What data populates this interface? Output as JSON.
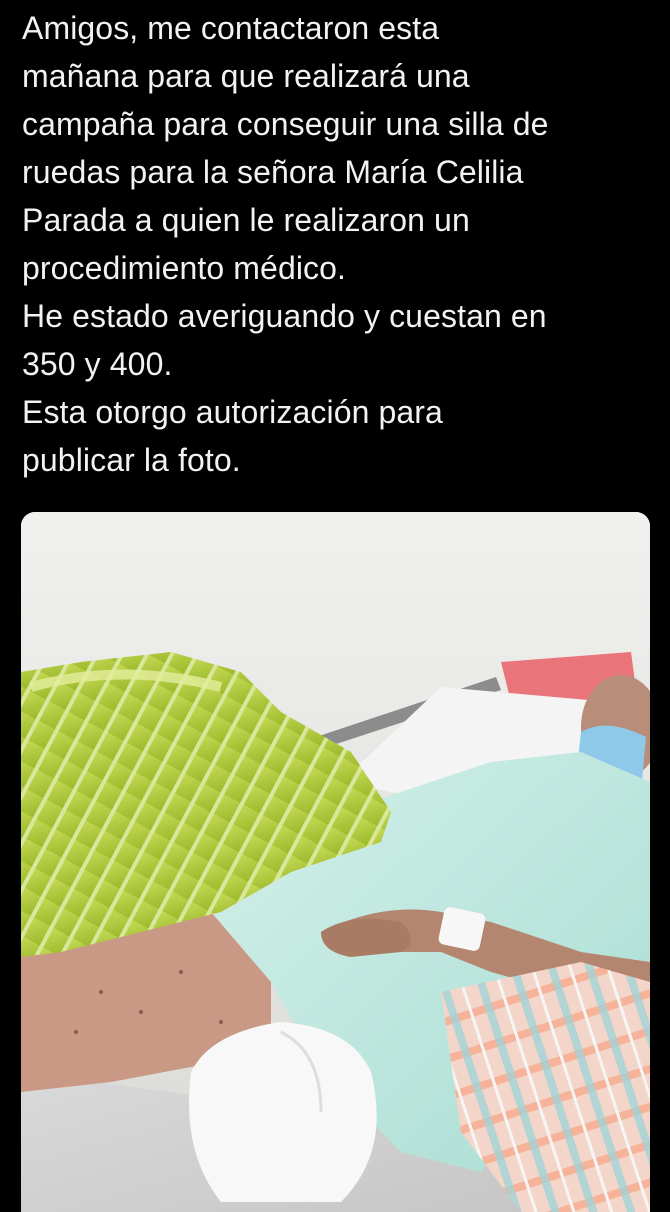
{
  "post": {
    "lines": [
      "Amigos, me contactaron esta",
      "mañana para que realizará una",
      "campaña para conseguir una silla de",
      "ruedas para la señora María Celilia",
      "Parada a quien le realizaron un",
      "procedimiento médico.",
      "He estado averiguando y cuestan en",
      "350 y 400.",
      "Esta otorgo autorización para",
      "publicar la foto."
    ]
  },
  "colors": {
    "background": "#000000",
    "text": "#f2f2f2",
    "wall": "#e9e9e7",
    "blanket_green": "#b6cf3c",
    "gown": "#bfe8e0",
    "mask": "#8ec9ea"
  },
  "photo": {
    "description_icon": "photo-icon"
  }
}
